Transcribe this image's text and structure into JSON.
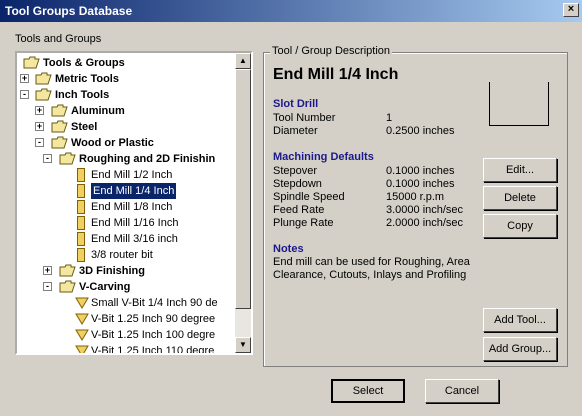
{
  "window": {
    "title": "Tool Groups Database",
    "close_glyph": "×"
  },
  "left_group": {
    "label": "Tools and Groups"
  },
  "tree": [
    {
      "label": "Tools & Groups",
      "level": 0,
      "kind": "folder",
      "expander": "",
      "bold": true
    },
    {
      "label": "Metric Tools",
      "level": 1,
      "kind": "folder",
      "expander": "+",
      "bold": true
    },
    {
      "label": "Inch Tools",
      "level": 1,
      "kind": "folder",
      "expander": "-",
      "bold": true
    },
    {
      "label": "Aluminum",
      "level": 2,
      "kind": "folder",
      "expander": "+",
      "bold": true
    },
    {
      "label": "Steel",
      "level": 2,
      "kind": "folder",
      "expander": "+",
      "bold": true
    },
    {
      "label": "Wood or Plastic",
      "level": 2,
      "kind": "folder",
      "expander": "-",
      "bold": true
    },
    {
      "label": "Roughing and 2D Finishin",
      "level": 3,
      "kind": "folder",
      "expander": "-",
      "bold": true
    },
    {
      "label": "End Mill 1/2 Inch",
      "level": 4,
      "kind": "tool",
      "expander": "",
      "bold": false
    },
    {
      "label": "End Mill 1/4 Inch",
      "level": 4,
      "kind": "tool",
      "expander": "",
      "bold": false,
      "selected": true
    },
    {
      "label": "End Mill 1/8 Inch",
      "level": 4,
      "kind": "tool",
      "expander": "",
      "bold": false
    },
    {
      "label": "End Mill 1/16 Inch",
      "level": 4,
      "kind": "tool",
      "expander": "",
      "bold": false
    },
    {
      "label": "End Mill 3/16 inch",
      "level": 4,
      "kind": "tool",
      "expander": "",
      "bold": false
    },
    {
      "label": "3/8 router bit",
      "level": 4,
      "kind": "tool",
      "expander": "",
      "bold": false
    },
    {
      "label": "3D Finishing",
      "level": 3,
      "kind": "folder",
      "expander": "+",
      "bold": true
    },
    {
      "label": "V-Carving",
      "level": 3,
      "kind": "folder",
      "expander": "-",
      "bold": true
    },
    {
      "label": "Small V-Bit 1/4 Inch 90 de",
      "level": 4,
      "kind": "vbit",
      "expander": "",
      "bold": false
    },
    {
      "label": "V-Bit 1.25 Inch 90 degree",
      "level": 4,
      "kind": "vbit",
      "expander": "",
      "bold": false
    },
    {
      "label": "V-Bit 1.25 Inch 100 degre",
      "level": 4,
      "kind": "vbit",
      "expander": "",
      "bold": false
    },
    {
      "label": "V-Bit 1.25 Inch 110 degre",
      "level": 4,
      "kind": "vbit",
      "expander": "",
      "bold": false
    }
  ],
  "scroll": {
    "up": "▲",
    "down": "▼"
  },
  "desc": {
    "legend": "Tool / Group Description",
    "tool_name": "End Mill 1/4 Inch",
    "type_heading": "Slot Drill",
    "props": [
      {
        "label": "Tool Number",
        "value": "1"
      },
      {
        "label": "Diameter",
        "value": "0.2500 inches"
      }
    ],
    "defaults_heading": "Machining Defaults",
    "defaults": [
      {
        "label": "Stepover",
        "value": "0.1000 inches"
      },
      {
        "label": "Stepdown",
        "value": "0.1000 inches"
      },
      {
        "label": "Spindle Speed",
        "value": "15000 r.p.m"
      },
      {
        "label": "Feed Rate",
        "value": "3.0000 inch/sec"
      },
      {
        "label": "Plunge Rate",
        "value": "2.0000 inch/sec"
      }
    ],
    "notes_heading": "Notes",
    "notes_lines": [
      "End mill can be used for Roughing, Area",
      "Clearance, Cutouts, Inlays and Profiling"
    ]
  },
  "buttons": {
    "edit": "Edit...",
    "delete": "Delete",
    "copy": "Copy",
    "add_tool": "Add Tool...",
    "add_group": "Add Group...",
    "select": "Select",
    "cancel": "Cancel"
  }
}
